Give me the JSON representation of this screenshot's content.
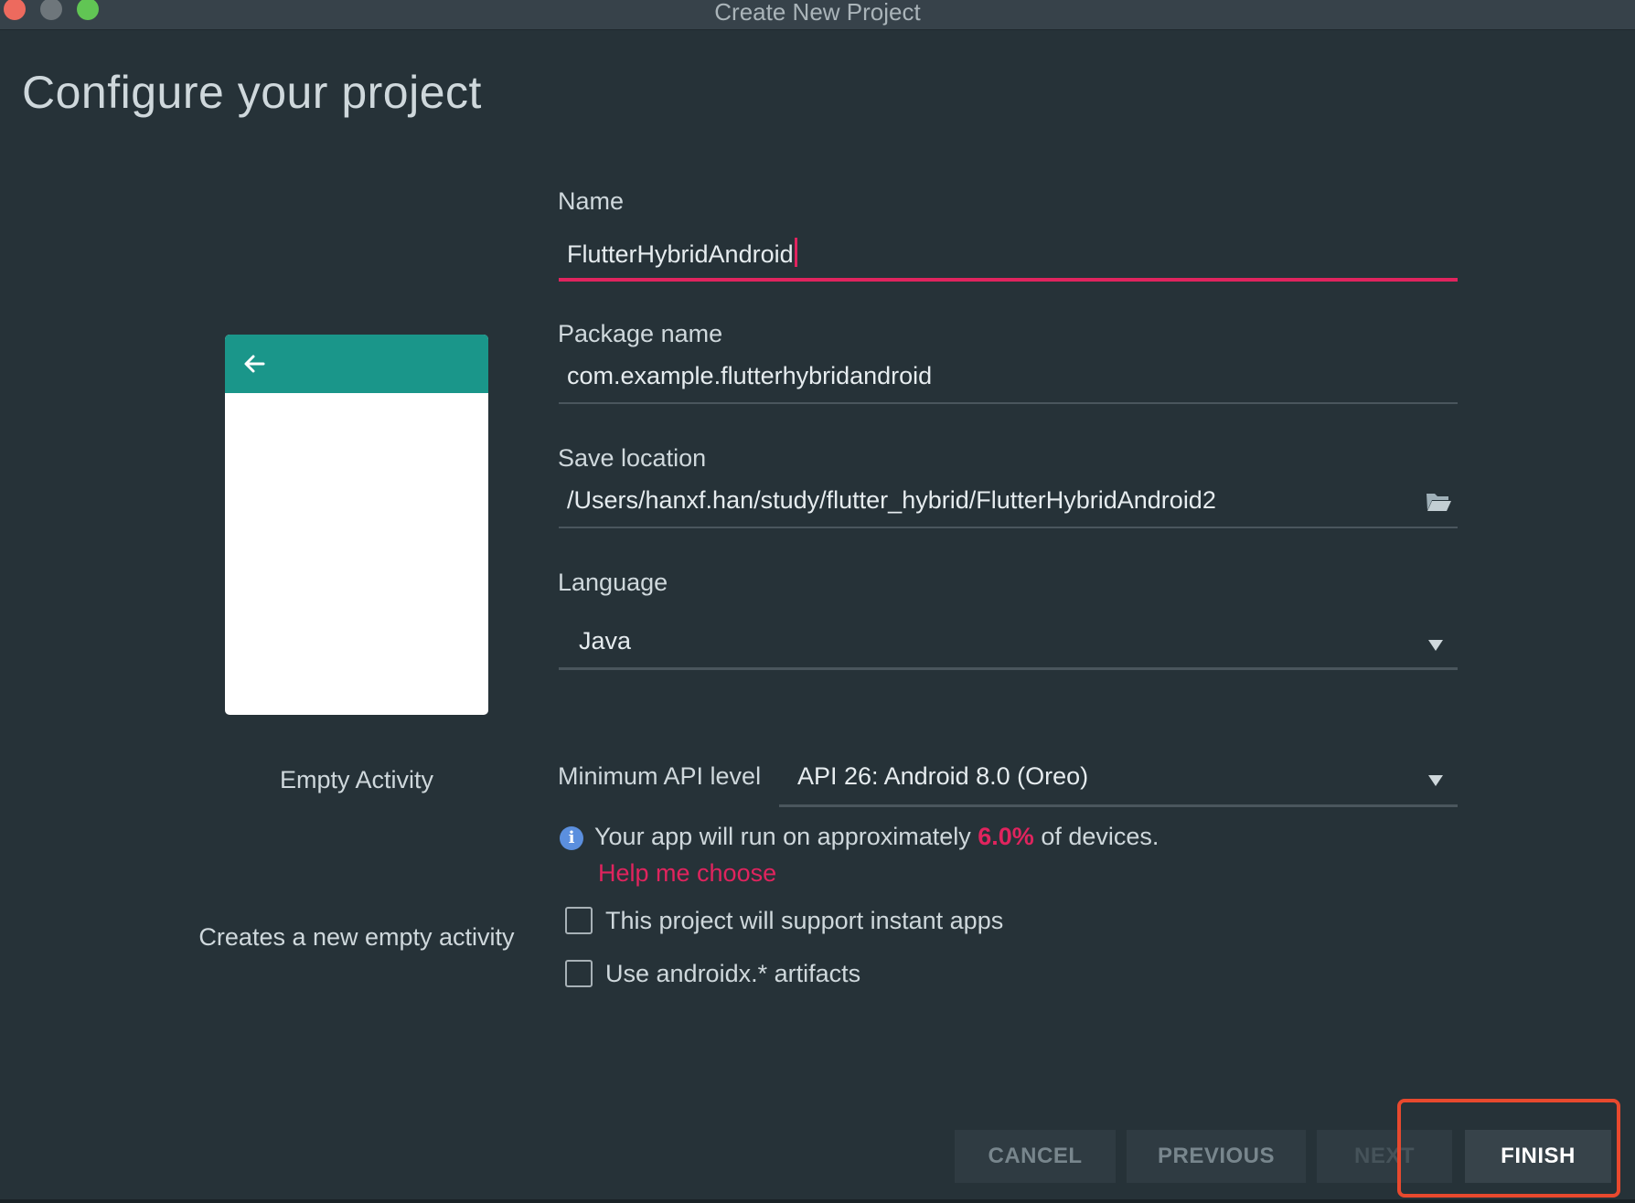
{
  "window": {
    "title": "Create New Project"
  },
  "page": {
    "heading": "Configure your project"
  },
  "template": {
    "name": "Empty Activity",
    "description": "Creates a new empty activity"
  },
  "form": {
    "name": {
      "label": "Name",
      "value": "FlutterHybridAndroid"
    },
    "package_name": {
      "label": "Package name",
      "value": "com.example.flutterhybridandroid"
    },
    "save_location": {
      "label": "Save location",
      "value": "/Users/hanxf.han/study/flutter_hybrid/FlutterHybridAndroid2"
    },
    "language": {
      "label": "Language",
      "value": "Java"
    },
    "min_api": {
      "label": "Minimum API level",
      "value": "API 26: Android 8.0 (Oreo)"
    },
    "info": {
      "prefix": "Your app will run on approximately",
      "percent": "6.0%",
      "suffix": "of devices.",
      "help_link": "Help me choose"
    },
    "checkboxes": [
      {
        "label": "This project will support instant apps",
        "checked": false
      },
      {
        "label": "Use androidx.* artifacts",
        "checked": false
      }
    ]
  },
  "buttons": {
    "cancel": "CANCEL",
    "previous": "PREVIOUS",
    "next": "NEXT",
    "finish": "FINISH"
  },
  "colors": {
    "background": "#263238",
    "accent": "#e0245e",
    "appbar": "#1a968a",
    "annotation_box": "#e8492e"
  },
  "icons": {
    "preview_back": "arrow-left-icon",
    "save_location": "folder-open-icon",
    "info": "info-icon"
  }
}
